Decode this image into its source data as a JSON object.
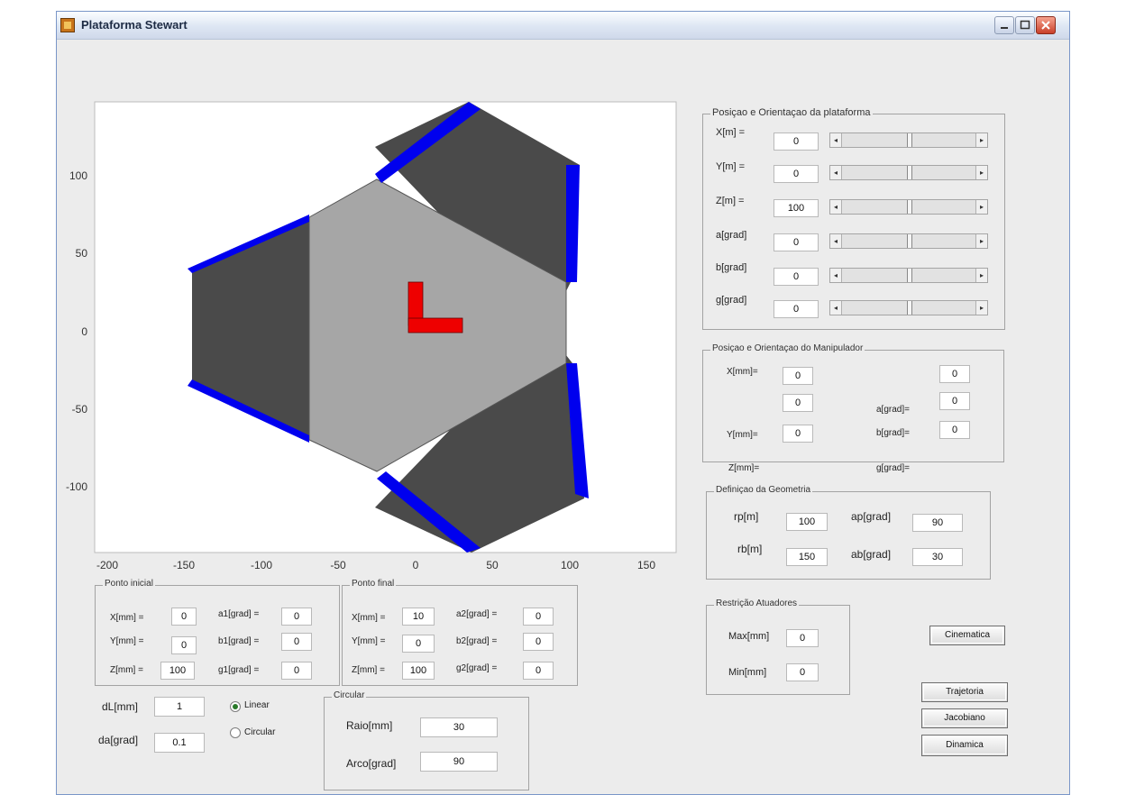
{
  "window": {
    "title": "Plataforma Stewart"
  },
  "plot": {
    "x_ticks": [
      "-200",
      "-150",
      "-100",
      "-50",
      "0",
      "50",
      "100",
      "150"
    ],
    "y_ticks": [
      "100",
      "50",
      "0",
      "-50",
      "-100"
    ]
  },
  "posicao_plataforma": {
    "title": "Posiçao e Orientaçao da plataforma",
    "rows": [
      {
        "label": "X[m] =",
        "value": "0"
      },
      {
        "label": "Y[m] =",
        "value": "0"
      },
      {
        "label": "Z[m] =",
        "value": "100"
      },
      {
        "label": "a[grad]",
        "value": "0"
      },
      {
        "label": "b[grad]",
        "value": "0"
      },
      {
        "label": "g[grad]",
        "value": "0"
      }
    ]
  },
  "posicao_manipulador": {
    "title": "Posiçao e Orientaçao do Manipulador",
    "labels": {
      "x": "X[mm]=",
      "y": "Y[mm]=",
      "z": "Z[mm]=",
      "a": "a[grad]=",
      "b": "b[grad]=",
      "g": "g[grad]="
    },
    "values": {
      "x": "0",
      "y": "0",
      "z": "0",
      "a": "0",
      "b": "0",
      "g": "0"
    }
  },
  "geometria": {
    "title": "Definiçao da Geometria",
    "rp_label": "rp[m]",
    "rp": "100",
    "rb_label": "rb[m]",
    "rb": "150",
    "ap_label": "ap[grad]",
    "ap": "90",
    "ab_label": "ab[grad]",
    "ab": "30"
  },
  "atuadores": {
    "title": "Restrição Atuadores",
    "max_label": "Max[mm]",
    "max": "0",
    "min_label": "Min[mm]",
    "min": "0"
  },
  "ponto_inicial": {
    "title": "Ponto inicial",
    "x_label": "X[mm] =",
    "x": "0",
    "y_label": "Y[mm] =",
    "y": "0",
    "z_label": "Z[mm] =",
    "z": "100",
    "a_label": "a1[grad] =",
    "a": "0",
    "b_label": "b1[grad] =",
    "b": "0",
    "g_label": "g1[grad] =",
    "g": "0"
  },
  "ponto_final": {
    "title": "Ponto final",
    "x_label": "X[mm] =",
    "x": "10",
    "y_label": "Y[mm] =",
    "y": "0",
    "z_label": "Z[mm] =",
    "z": "100",
    "a_label": "a2[grad] =",
    "a": "0",
    "b_label": "b2[grad] =",
    "b": "0",
    "g_label": "g2[grad] =",
    "g": "0"
  },
  "passo": {
    "dl_label": "dL[mm]",
    "dl": "1",
    "da_label": "da[grad]",
    "da": "0.1"
  },
  "trajetoria_tipo": {
    "linear": "Linear",
    "circular": "Circular",
    "selected": "Linear"
  },
  "circular": {
    "title": "Circular",
    "raio_label": "Raio[mm]",
    "raio": "30",
    "arco_label": "Arco[grad]",
    "arco": "90"
  },
  "buttons": {
    "cinematica": "Cinematica",
    "trajetoria": "Trajetoria",
    "jacobiano": "Jacobiano",
    "dinamica": "Dinamica"
  },
  "colors": {
    "actuator": "#0000ee",
    "base": "#4a4a4a",
    "platform": "#a6a6a6",
    "marker": "#ee0000"
  }
}
